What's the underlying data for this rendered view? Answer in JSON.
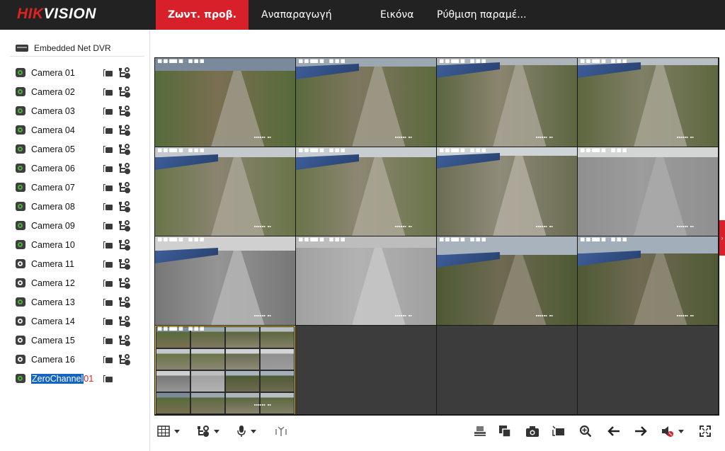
{
  "brand": {
    "logo_part1": "HIK",
    "logo_part2": "VISION"
  },
  "nav": {
    "items": [
      {
        "label": "Ζωντ. προβ.",
        "active": true
      },
      {
        "label": "Αναπαραγωγή",
        "active": false
      },
      {
        "label": "Εικόνα",
        "active": false
      },
      {
        "label": "Ρύθμιση παραμέ...",
        "active": false
      }
    ]
  },
  "sidebar": {
    "device_label": "Embedded Net DVR",
    "cameras": [
      {
        "label": "Camera 01",
        "online": true
      },
      {
        "label": "Camera 02",
        "online": true
      },
      {
        "label": "Camera 03",
        "online": true
      },
      {
        "label": "Camera 04",
        "online": true
      },
      {
        "label": "Camera 05",
        "online": true
      },
      {
        "label": "Camera 06",
        "online": true
      },
      {
        "label": "Camera 07",
        "online": true
      },
      {
        "label": "Camera 08",
        "online": true
      },
      {
        "label": "Camera 09",
        "online": true
      },
      {
        "label": "Camera 10",
        "online": true
      },
      {
        "label": "Camera 11",
        "online": false
      },
      {
        "label": "Camera 12",
        "online": false
      },
      {
        "label": "Camera 13",
        "online": true
      },
      {
        "label": "Camera 14",
        "online": false
      },
      {
        "label": "Camera 15",
        "online": false
      },
      {
        "label": "Camera 16",
        "online": false
      }
    ],
    "zero_channel": {
      "label": "ZeroChannel",
      "number": "01"
    }
  },
  "colors": {
    "accent": "#d7202a",
    "topbar": "#222222",
    "selection": "#1565c0",
    "selected_tile": "#e8c21a"
  },
  "toolbar": {
    "left_icons": [
      "layout-grid-icon",
      "ptz-split-icon",
      "microphone-icon",
      "antenna-icon"
    ],
    "right_icons": [
      "stop-all-icon",
      "capture-all-icon",
      "snapshot-icon",
      "record-icon",
      "zoom-in-icon",
      "previous-page-icon",
      "next-page-icon",
      "volume-icon",
      "fullscreen-icon"
    ]
  }
}
